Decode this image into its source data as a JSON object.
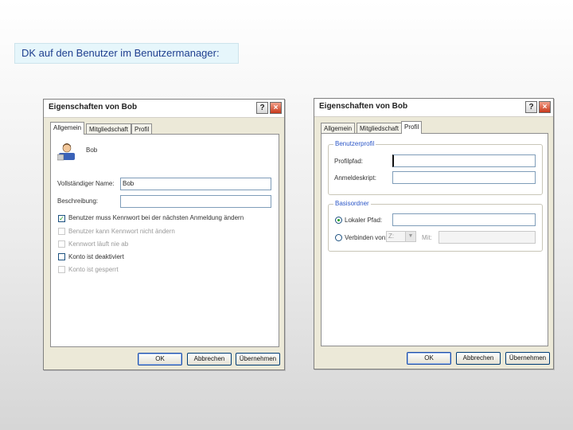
{
  "caption": "DK auf den Benutzer im Benutzermanager:",
  "dialog_left": {
    "title": "Eigenschaften von Bob",
    "help_btn": "?",
    "close_btn": "×",
    "tabs": [
      "Allgemein",
      "Mitgliedschaft",
      "Profil"
    ],
    "user_name": "Bob",
    "fullname_label": "Vollständiger Name:",
    "fullname_value": "Bob",
    "description_label": "Beschreibung:",
    "description_value": "",
    "checkboxes": [
      {
        "label": "Benutzer muss Kennwort bei der nächsten Anmeldung ändern",
        "checked": true,
        "enabled": true
      },
      {
        "label": "Benutzer kann Kennwort nicht ändern",
        "checked": false,
        "enabled": false
      },
      {
        "label": "Kennwort läuft nie ab",
        "checked": false,
        "enabled": false
      },
      {
        "label": "Konto ist deaktiviert",
        "checked": false,
        "enabled": true
      },
      {
        "label": "Konto ist gesperrt",
        "checked": false,
        "enabled": false
      }
    ],
    "buttons": {
      "ok": "OK",
      "cancel": "Abbrechen",
      "apply": "Übernehmen"
    }
  },
  "dialog_right": {
    "title": "Eigenschaften von Bob",
    "help_btn": "?",
    "close_btn": "×",
    "tabs": [
      "Allgemein",
      "Mitgliedschaft",
      "Profil"
    ],
    "group_profile": "Benutzerprofil",
    "profile_path_label": "Profilpfad:",
    "profile_path_value": "",
    "logon_script_label": "Anmeldeskript:",
    "logon_script_value": "",
    "group_home": "Basisordner",
    "local_path_label": "Lokaler Pfad:",
    "local_path_value": "",
    "connect_label": "Verbinden von:",
    "drive_value": "Z:",
    "with_label": "Mit:",
    "with_value": "",
    "buttons": {
      "ok": "OK",
      "cancel": "Abbrechen",
      "apply": "Übernehmen"
    }
  }
}
